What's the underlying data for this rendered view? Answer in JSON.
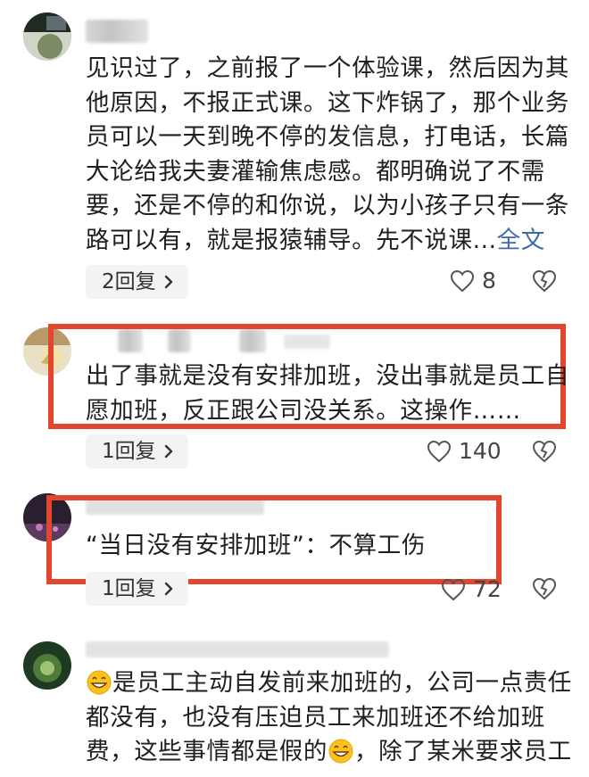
{
  "comments": [
    {
      "text": "见识过了，之前报了一个体验课，然后因为其他原因，不报正式课。这下炸锅了，那个业务员可以一天到晚不停的发信息，打电话，长篇大论给我夫妻灌输焦虑感。都明确说了不需要，还是不停的和你说，以为小孩子只有一条路可以有，就是报猿辅导。先不说课...",
      "expand_label": "全文",
      "reply_label": "2回复",
      "likes": "8",
      "highlighted": false
    },
    {
      "text": "出了事就是没有安排加班，没出事就是员工自愿加班，反正跟公司没关系。这操作……",
      "reply_label": "1回复",
      "likes": "140",
      "highlighted": true
    },
    {
      "text": "“当日没有安排加班”：不算工伤",
      "reply_label": "1回复",
      "likes": "72",
      "highlighted": true
    },
    {
      "text_part1": "是员工主动自发前来加班的，公司一点责任都没有，也没有压迫员工来加班还不给加班费，这些事情都是假的",
      "text_part2": "，除了某米要求员工",
      "emoji": "grinning-face-emoji",
      "highlighted": false
    }
  ],
  "colors": {
    "highlight_border": "#e2462e",
    "link": "#3d6aa8",
    "reply_bg": "#f3f3f3"
  }
}
